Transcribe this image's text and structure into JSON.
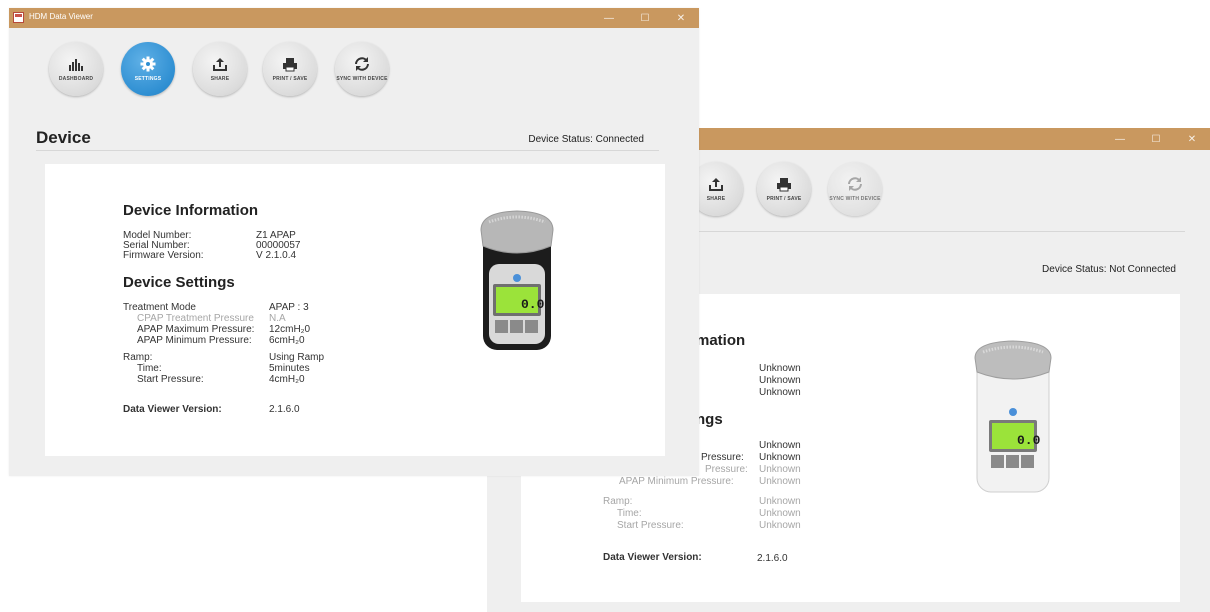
{
  "app": {
    "title": "HDM Data Viewer"
  },
  "window_controls": {
    "minimize": "—",
    "maximize": "☐",
    "close": "✕"
  },
  "toolbar": [
    {
      "name": "dashboard",
      "label": "DASHBOARD",
      "icon": "bar-chart-icon"
    },
    {
      "name": "settings",
      "label": "SETTINGS",
      "icon": "gear-icon"
    },
    {
      "name": "share",
      "label": "SHARE",
      "icon": "upload-icon"
    },
    {
      "name": "print-save",
      "label": "PRINT / SAVE",
      "icon": "printer-icon"
    },
    {
      "name": "sync",
      "label": "SYNC WITH DEVICE",
      "icon": "sync-icon"
    }
  ],
  "front": {
    "page_title": "Device",
    "status": "Device Status: Connected",
    "device_information": {
      "title": "Device Information",
      "rows": [
        {
          "label": "Model Number:",
          "value": "Z1 APAP"
        },
        {
          "label": "Serial Number:",
          "value": "00000057"
        },
        {
          "label": "Firmware Version:",
          "value": "V 2.1.0.4"
        }
      ]
    },
    "device_settings": {
      "title": "Device Settings",
      "treatment_mode": {
        "label": "Treatment Mode",
        "value": "APAP : 3"
      },
      "cpap_pressure": {
        "label": "CPAP Treatment Pressure",
        "value": "N.A"
      },
      "apap_max": {
        "label": "APAP Maximum Pressure:",
        "value": "12cmH₂0"
      },
      "apap_min": {
        "label": "APAP Minimum Pressure:",
        "value": "6cmH₂0"
      },
      "ramp": {
        "label": "Ramp:",
        "value": "Using Ramp"
      },
      "time": {
        "label": "Time:",
        "value": "5minutes"
      },
      "start_pressure": {
        "label": "Start Pressure:",
        "value": "4cmH₂0"
      }
    },
    "viewer_version": {
      "label": "Data Viewer Version:",
      "value": "2.1.6.0"
    }
  },
  "back": {
    "status": "Device Status: Not Connected",
    "info_title_partial": "mation",
    "settings_title_partial": "ngs",
    "info_values": [
      "Unknown",
      "Unknown",
      "Unknown"
    ],
    "settings_rows": [
      {
        "label": "",
        "value": "Unknown",
        "muted": false
      },
      {
        "label": "Pressure:",
        "value": "Unknown",
        "muted": false
      },
      {
        "label": "Pressure:",
        "value": "Unknown",
        "muted": true
      },
      {
        "label": "APAP Minimum Pressure:",
        "value": "Unknown",
        "muted": true
      },
      {
        "label": "Ramp:",
        "value": "Unknown",
        "muted": true
      },
      {
        "label": "Time:",
        "value": "Unknown",
        "muted": true
      },
      {
        "label": "Start Pressure:",
        "value": "Unknown",
        "muted": true
      }
    ],
    "viewer_version": {
      "label": "Data Viewer Version:",
      "value": "2.1.6.0"
    }
  },
  "device_display": {
    "reading": "0.0"
  },
  "colors": {
    "titlebar": "#c9985f",
    "accent": "#2f8fd2",
    "lcd": "#9be33a"
  }
}
